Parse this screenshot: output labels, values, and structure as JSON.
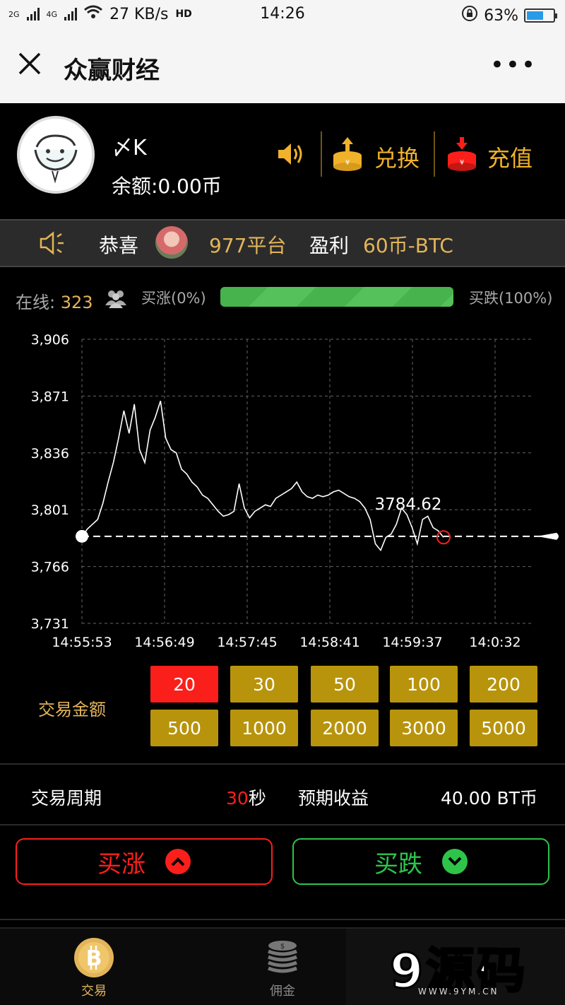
{
  "status_bar": {
    "network": "2G",
    "network2": "4G",
    "speed": "27 KB/s",
    "hd": "HD",
    "time": "14:26",
    "battery": "63%",
    "battery_level": 0.63
  },
  "header": {
    "title": "众赢财经",
    "more": "•••"
  },
  "user": {
    "name": "〆K",
    "balance": "余额:0.00币"
  },
  "actions": {
    "exchange": "兑换",
    "recharge": "充值"
  },
  "ticker": {
    "congrats": "恭喜",
    "platform": "977平台",
    "profit_label": "盈利",
    "profit_value": "60币-BTC"
  },
  "online": {
    "label": "在线:",
    "count": "323",
    "rise_pct": "买涨(0%)",
    "fall_pct": "买跌(100%)",
    "fall_ratio": 1.0
  },
  "chart_data": {
    "type": "line",
    "y_ticks": [
      "3,906",
      "3,871",
      "3,836",
      "3,801",
      "3,766",
      "3,731"
    ],
    "x_ticks": [
      "14:55:53",
      "14:56:49",
      "14:57:45",
      "14:58:41",
      "14:59:37",
      "14:0:32"
    ],
    "ylim": [
      3731,
      3906
    ],
    "current_value": "3784.62",
    "current_price": 3784.62,
    "series": [
      {
        "values": [
          3784,
          3789,
          3792,
          3795,
          3805,
          3818,
          3830,
          3845,
          3862,
          3848,
          3866,
          3838,
          3830,
          3850,
          3858,
          3868,
          3845,
          3838,
          3836,
          3826,
          3823,
          3818,
          3815,
          3810,
          3808,
          3804,
          3800,
          3797,
          3798,
          3800,
          3817,
          3802,
          3796,
          3800,
          3802,
          3804,
          3803,
          3808,
          3810,
          3812,
          3814,
          3818,
          3812,
          3809,
          3808,
          3810,
          3809,
          3810,
          3812,
          3813,
          3811,
          3809,
          3808,
          3806,
          3802,
          3795,
          3780,
          3776,
          3784,
          3786,
          3792,
          3802,
          3798,
          3790,
          3780,
          3795,
          3797,
          3790,
          3788,
          3784
        ]
      }
    ]
  },
  "amount": {
    "label": "交易金额",
    "options": [
      "20",
      "30",
      "50",
      "100",
      "200",
      "500",
      "1000",
      "2000",
      "3000",
      "5000"
    ],
    "selected": "20"
  },
  "period": {
    "label": "交易周期",
    "value": "30",
    "unit": "秒",
    "expect_label": "预期收益",
    "expect_value": "40.00 BT币"
  },
  "buttons": {
    "rise": "买涨",
    "fall": "买跌"
  },
  "nav": {
    "trade": "交易",
    "commission": "佣金"
  },
  "watermark": {
    "big": "9源码",
    "url": "WWW.9YM.CN"
  },
  "colors": {
    "gold": "#e3b55a",
    "red": "#fa1f1a",
    "green": "#2ec44a",
    "amount_bg": "#b8940c"
  }
}
